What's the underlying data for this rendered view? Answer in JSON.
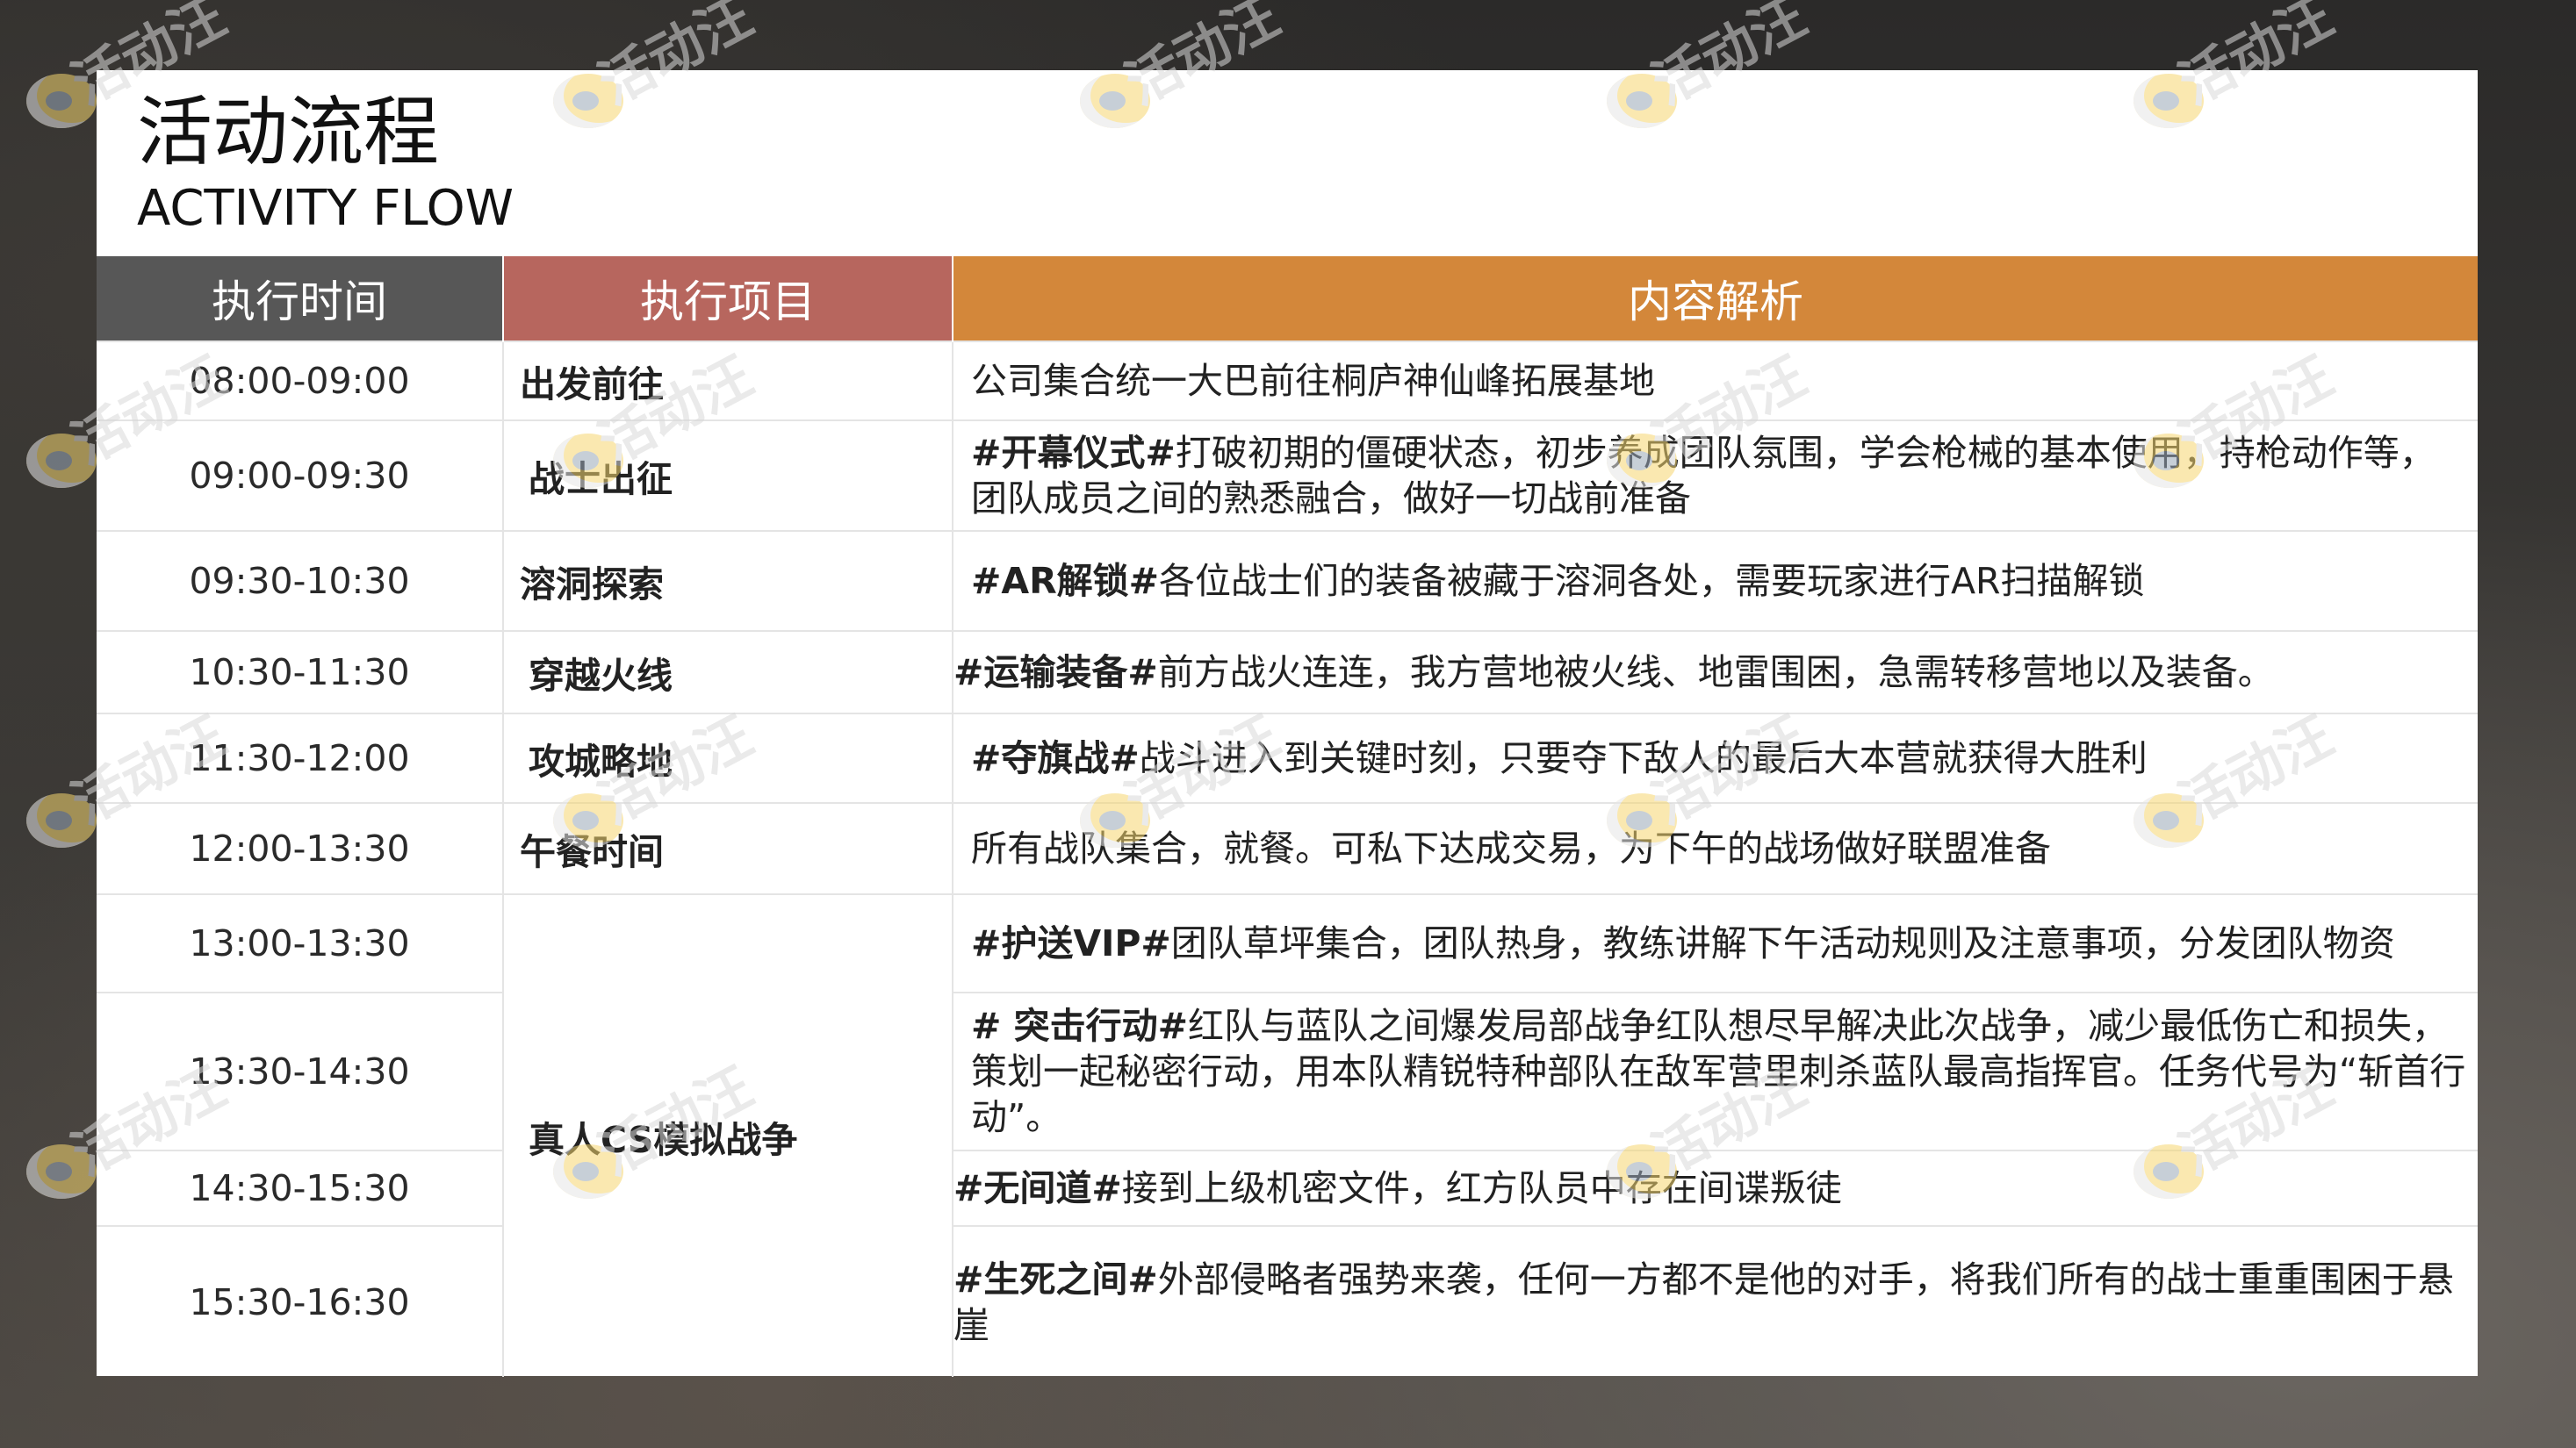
{
  "title": {
    "zh": "活动流程",
    "en": "ACTIVITY FLOW"
  },
  "headers": {
    "time": "执行时间",
    "item": "执行项目",
    "desc": "内容解析"
  },
  "rows": [
    {
      "time": "08:00-09:00",
      "item": "出发前往",
      "tag": "",
      "text": "公司集合统一大巴前往桐庐神仙峰拓展基地"
    },
    {
      "time": "09:00-09:30",
      "item": "战士出征",
      "tag": "#开幕仪式#",
      "text": "打破初期的僵硬状态，初步养成团队氛围，学会枪械的基本使用，持枪动作等，团队成员之间的熟悉融合，做好一切战前准备"
    },
    {
      "time": "09:30-10:30",
      "item": "溶洞探索",
      "tag": "#AR解锁#",
      "text": "各位战士们的装备被藏于溶洞各处，需要玩家进行AR扫描解锁"
    },
    {
      "time": "10:30-11:30",
      "item": "穿越火线",
      "tag": "#运输装备#",
      "text": "前方战火连连，我方营地被火线、地雷围困，急需转移营地以及装备。"
    },
    {
      "time": "11:30-12:00",
      "item": "攻城略地",
      "tag": "#夺旗战#",
      "text": "战斗进入到关键时刻，只要夺下敌人的最后大本营就获得大胜利"
    },
    {
      "time": "12:00-13:30",
      "item": "午餐时间",
      "tag": "",
      "text": "所有战队集合，就餐。可私下达成交易，为下午的战场做好联盟准备"
    },
    {
      "time": "13:00-13:30",
      "item": "真人CS模拟战争",
      "tag": "#护送VIP#",
      "text": "团队草坪集合，团队热身，教练讲解下午活动规则及注意事项，分发团队物资"
    },
    {
      "time": "13:30-14:30",
      "item": "",
      "tag": "# 突击行动#",
      "text": "红队与蓝队之间爆发局部战争红队想尽早解决此次战争，减少最低伤亡和损失，策划一起秘密行动，用本队精锐特种部队在敌军营里刺杀蓝队最高指挥官。任务代号为“斩首行动”。"
    },
    {
      "time": "14:30-15:30",
      "item": "",
      "tag": "#无间道#",
      "text": "接到上级机密文件，红方队员中存在间谍叛徒"
    },
    {
      "time": "15:30-16:30",
      "item": "",
      "tag": "#生死之间#",
      "text": "外部侵略者强势来袭，任何一方都不是他的对手，将我们所有的战士重重围困于悬崖"
    }
  ],
  "watermark": {
    "text": "活动汪",
    "icon": "mascot-logo-icon"
  }
}
